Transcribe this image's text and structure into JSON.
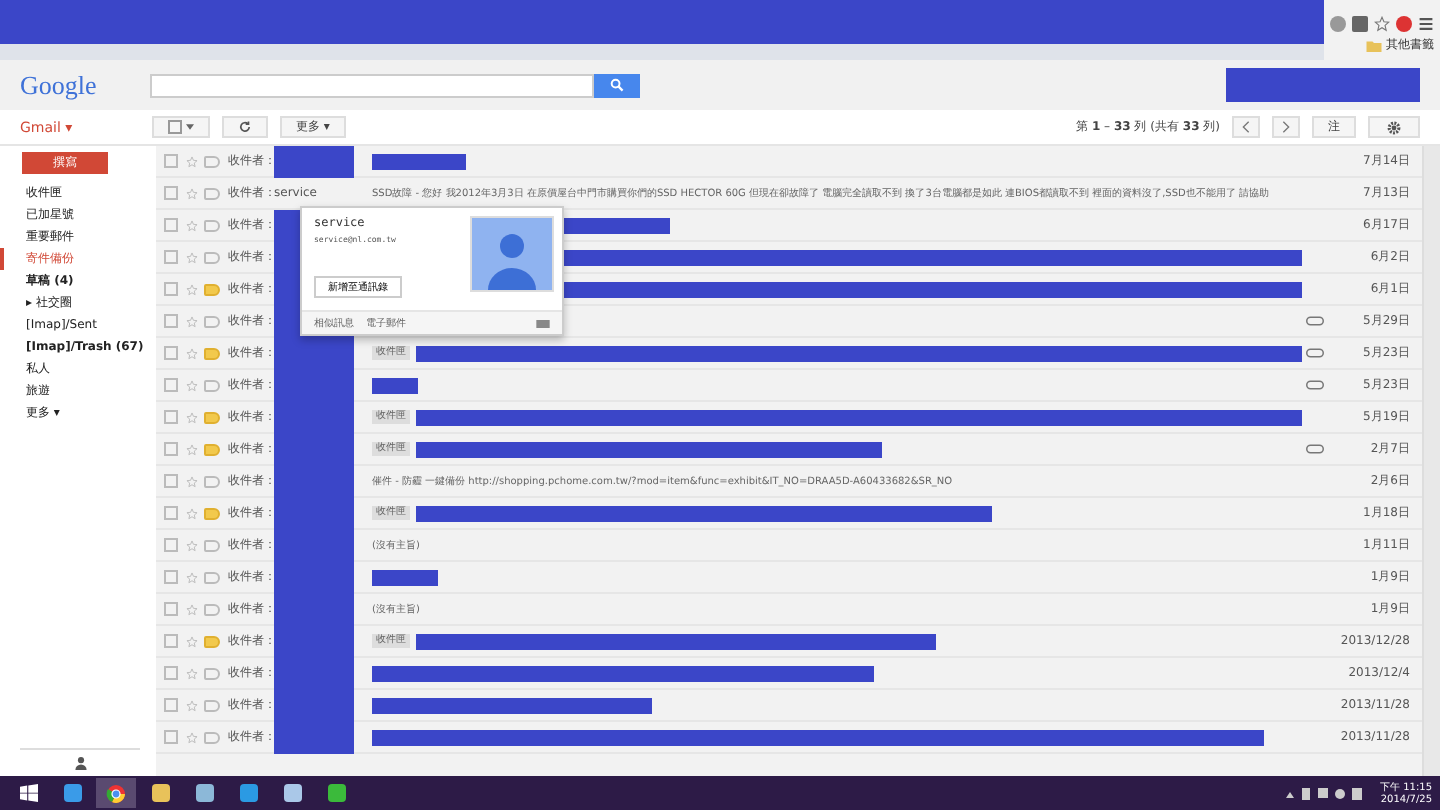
{
  "browser": {
    "bookmarks_label": "其他書籤"
  },
  "header": {
    "logo": "Google"
  },
  "toolbar": {
    "account": "Gmail ▾",
    "more_button": "更多 ▾",
    "page_info": "第 **1** – **33** 列 (共有 **33** 列)",
    "input_tool": "注"
  },
  "sidebar": {
    "compose": "撰寫",
    "items": [
      {
        "label": "收件匣",
        "selected": false,
        "bold": false
      },
      {
        "label": "已加星號",
        "selected": false,
        "bold": false
      },
      {
        "label": "重要郵件",
        "selected": false,
        "bold": false
      },
      {
        "label": "寄件備份",
        "selected": true,
        "bold": false
      },
      {
        "label": "草稿 (4)",
        "selected": false,
        "bold": true
      },
      {
        "label": "▸ 社交圈",
        "selected": false,
        "bold": false
      },
      {
        "label": "[Imap]/Sent",
        "selected": false,
        "bold": false
      },
      {
        "label": "[Imap]/Trash (67)",
        "selected": false,
        "bold": true
      },
      {
        "label": "私人",
        "selected": false,
        "bold": false
      },
      {
        "label": "旅遊",
        "selected": false,
        "bold": false
      },
      {
        "label": "更多 ▾",
        "selected": false,
        "bold": false
      }
    ]
  },
  "messages": [
    {
      "folder": "收件者：",
      "sender_redacted": true,
      "important": false,
      "checked": false,
      "subject_redacted": true,
      "attachment": false,
      "date": "7月14日"
    },
    {
      "folder": "收件者：",
      "sender": "service",
      "sender_redacted": false,
      "important": false,
      "checked": false,
      "subject": "SSD故障 - 您好 我2012年3月3日 在原價屋台中門市購買你們的SSD HECTOR 60G 但現在卻故障了 電腦完全讀取不到 換了3台電腦都是如此 連BIOS都讀取不到 裡面的資料沒了,SSD也不能用了 請協助",
      "subject_redacted": false,
      "attachment": false,
      "date": "7月13日"
    },
    {
      "folder": "收件者：",
      "sender_redacted": true,
      "important": false,
      "checked": false,
      "subject_redacted": true,
      "attachment": false,
      "date": "6月17日"
    },
    {
      "folder": "收件者：",
      "sender_redacted": true,
      "important": false,
      "checked": false,
      "subject_redacted": true,
      "attachment": false,
      "date": "6月2日"
    },
    {
      "folder": "收件者：",
      "sender_redacted": true,
      "important": true,
      "checked": false,
      "subject_redacted": true,
      "attachment": false,
      "date": "6月1日"
    },
    {
      "folder": "收件者：",
      "sender_redacted": true,
      "important": false,
      "checked": false,
      "subject_redacted": false,
      "attachment": true,
      "date": "5月29日"
    },
    {
      "folder": "收件者：",
      "sender_redacted": true,
      "important": true,
      "checked": false,
      "label": "收件匣",
      "subject_redacted": true,
      "attachment": true,
      "date": "5月23日"
    },
    {
      "folder": "收件者：",
      "sender_redacted": true,
      "important": false,
      "checked": false,
      "subject_redacted": true,
      "attachment": true,
      "date": "5月23日"
    },
    {
      "folder": "收件者：",
      "sender_redacted": true,
      "important": true,
      "checked": false,
      "label": "收件匣",
      "subject_redacted": true,
      "attachment": false,
      "date": "5月19日"
    },
    {
      "folder": "收件者：",
      "sender_redacted": true,
      "important": true,
      "checked": false,
      "label": "收件匣",
      "subject_redacted": true,
      "attachment": true,
      "date": "2月7日"
    },
    {
      "folder": "收件者：",
      "sender_redacted": true,
      "important": false,
      "checked": false,
      "subject": "催件 - 防霾 一鍵備份 http://shopping.pchome.com.tw/?mod=item&func=exhibit&IT_NO=DRAA5D-A60433682&SR_NO",
      "subject_redacted": false,
      "attachment": false,
      "date": "2月6日"
    },
    {
      "folder": "收件者：",
      "sender_redacted": true,
      "important": true,
      "checked": false,
      "label": "收件匣",
      "subject_redacted": true,
      "attachment": false,
      "date": "1月18日"
    },
    {
      "folder": "收件者：",
      "sender_redacted": true,
      "important": false,
      "checked": false,
      "subject": "(沒有主旨)",
      "subject_redacted": false,
      "attachment": false,
      "date": "1月11日"
    },
    {
      "folder": "收件者：",
      "sender_redacted": true,
      "important": false,
      "checked": false,
      "subject_redacted": true,
      "attachment": false,
      "date": "1月9日"
    },
    {
      "folder": "收件者：",
      "sender_redacted": true,
      "important": false,
      "checked": false,
      "subject": "(沒有主旨)",
      "subject_redacted": false,
      "attachment": false,
      "date": "1月9日"
    },
    {
      "folder": "收件者：",
      "sender_redacted": true,
      "important": true,
      "checked": false,
      "label": "收件匣",
      "subject_redacted": true,
      "attachment": false,
      "date": "2013/12/28"
    },
    {
      "folder": "收件者：",
      "sender_redacted": true,
      "important": false,
      "checked": false,
      "subject_redacted": true,
      "attachment": false,
      "date": "2013/12/4"
    },
    {
      "folder": "收件者：",
      "sender_redacted": true,
      "important": false,
      "checked": false,
      "subject_redacted": true,
      "attachment": false,
      "date": "2013/11/28"
    },
    {
      "folder": "收件者：",
      "sender_redacted": true,
      "important": false,
      "checked": false,
      "subject_redacted": true,
      "attachment": false,
      "date": "2013/11/28"
    }
  ],
  "contact_card": {
    "name": "service",
    "email": "service@nl.com.tw",
    "add_button": "新增至通訊錄",
    "footer_links": [
      "相似訊息",
      "電子郵件"
    ]
  },
  "taskbar": {
    "time": "下午 11:15",
    "date": "2014/7/25"
  }
}
